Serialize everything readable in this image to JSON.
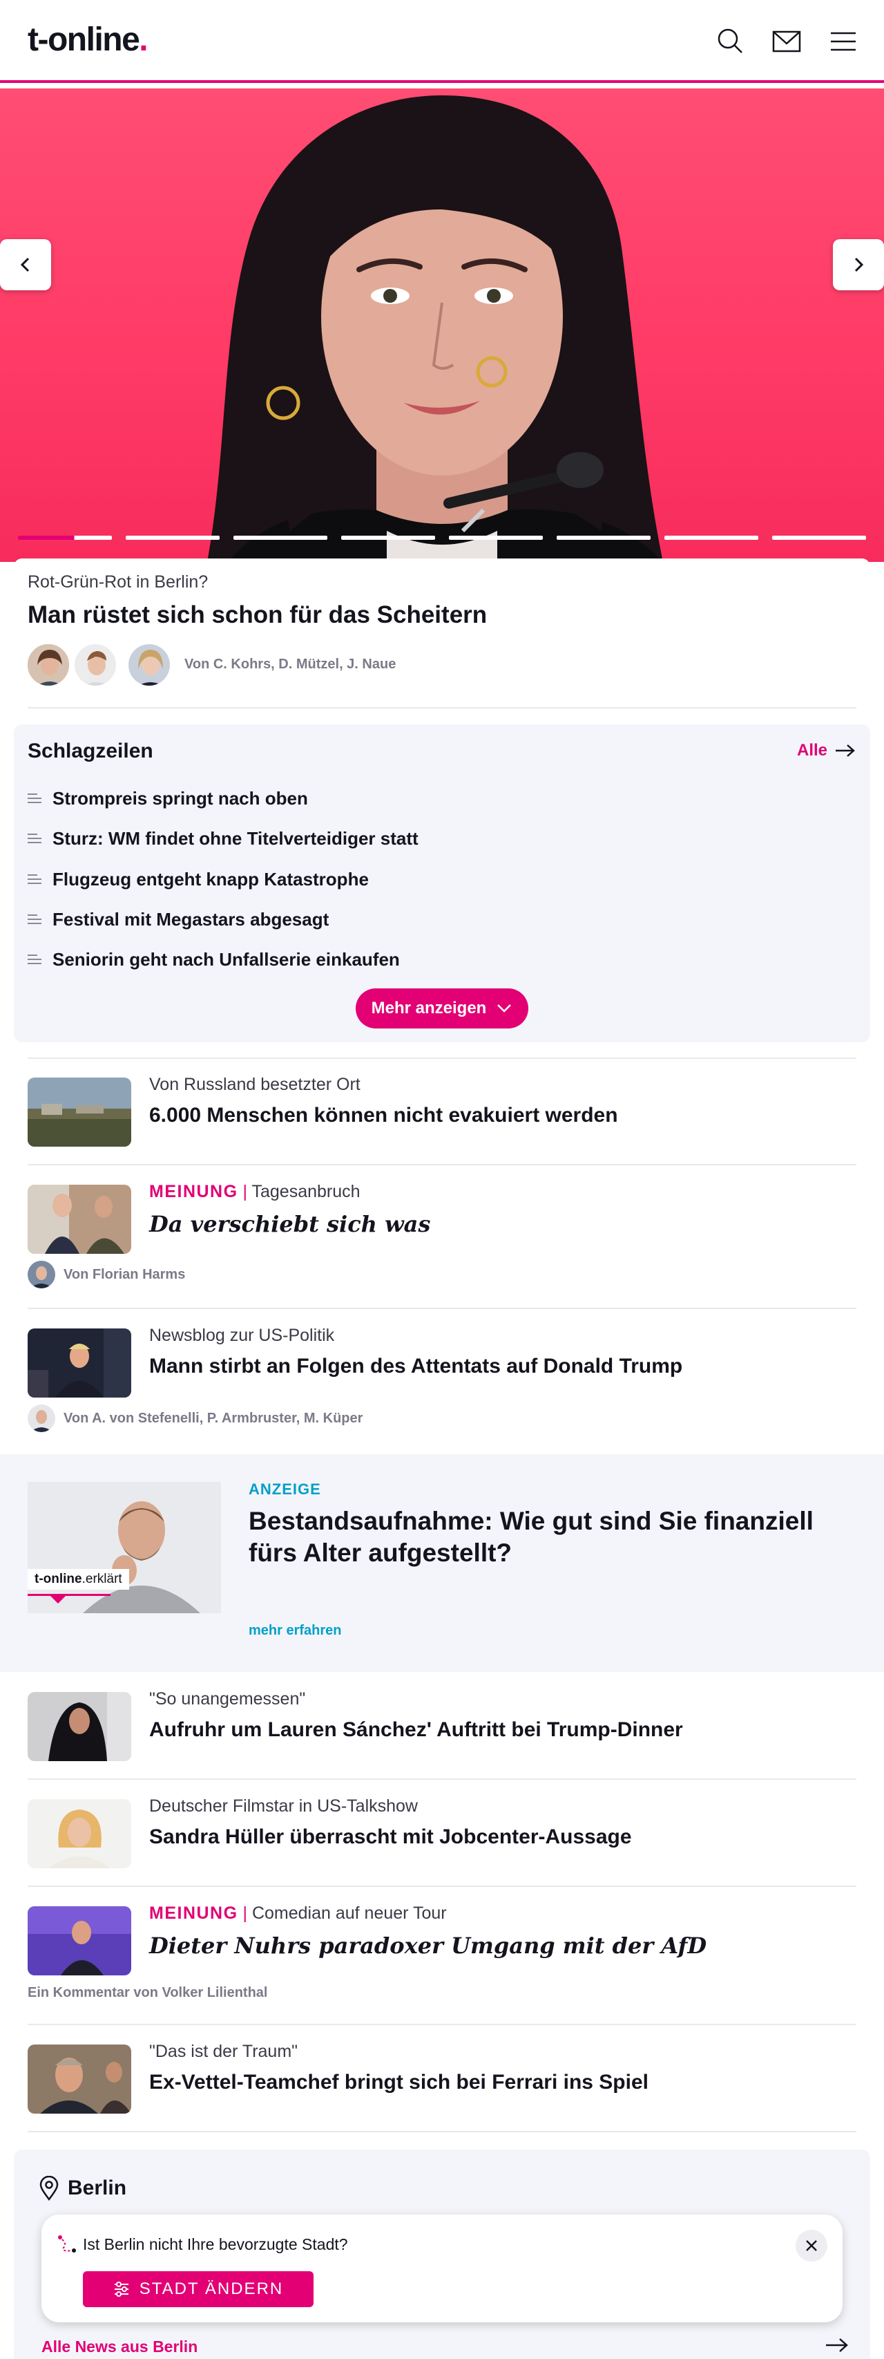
{
  "header": {
    "logo_text": "t-online",
    "logo_dot": ".",
    "icons": [
      "search-icon",
      "mail-icon",
      "menu-icon"
    ]
  },
  "hero": {
    "kicker": "Rot-Grün-Rot in Berlin?",
    "headline": "Man rüstet sich schon für das Scheitern",
    "byline": "Von C. Kohrs, D. Mützel, J. Naue",
    "slides": 8,
    "active_slide": 1,
    "active_slide_progress": 0.6
  },
  "schlagzeilen": {
    "title": "Schlagzeilen",
    "all_label": "Alle",
    "items": [
      "Strompreis springt nach oben",
      "Sturz: WM findet ohne Titelverteidiger statt",
      "Flugzeug entgeht knapp Katastrophe",
      "Festival mit Megastars abgesagt",
      "Seniorin geht nach Unfallserie einkaufen"
    ],
    "more_label": "Mehr anzeigen"
  },
  "articles": [
    {
      "kicker": "Von Russland besetzter Ort",
      "title": "6.000 Menschen können nicht evakuiert werden"
    },
    {
      "kicker_tag": "MEINUNG",
      "kicker_sep": " | ",
      "kicker": "Tagesanbruch",
      "title": "Da verschiebt sich was",
      "byline": "Von Florian Harms"
    },
    {
      "kicker": "Newsblog zur US-Politik",
      "title": "Mann stirbt an Folgen des Attentats auf Donald Trump",
      "byline": "Von A. von Stefenelli, P. Armbruster, M. Küper"
    }
  ],
  "ad": {
    "label": "ANZEIGE",
    "title": "Bestandsaufnahme: Wie gut sind Sie finanziell fürs Alter aufgestellt?",
    "link": "mehr erfahren",
    "badge_brand": "t-online",
    "badge_suffix": ".erklärt"
  },
  "articles2": [
    {
      "kicker": "\"So unangemessen\"",
      "title": "Aufruhr um Lauren Sánchez' Auftritt bei Trump-Dinner"
    },
    {
      "kicker": "Deutscher Filmstar in US-Talkshow",
      "title": "Sandra Hüller überrascht mit Jobcenter-Aussage"
    },
    {
      "kicker_tag": "MEINUNG",
      "kicker_sep": " | ",
      "kicker": "Comedian auf neuer Tour",
      "title": "Dieter Nuhrs paradoxer Umgang mit der AfD",
      "byline": "Ein Kommentar von Volker Lilienthal"
    },
    {
      "kicker": "\"Das ist der Traum\"",
      "title": "Ex-Vettel-Teamchef bringt sich bei Ferrari ins Spiel"
    }
  ],
  "berlin": {
    "title": "Berlin",
    "popup_question": "Ist Berlin nicht Ihre bevorzugte Stadt?",
    "change_city_label": "STADT ÄNDERN",
    "all_news_label": "Alle News aus Berlin"
  },
  "colors": {
    "brand": "#e20074",
    "ad_accent": "#00a0c8",
    "hero_bg": "#ff4d73"
  }
}
